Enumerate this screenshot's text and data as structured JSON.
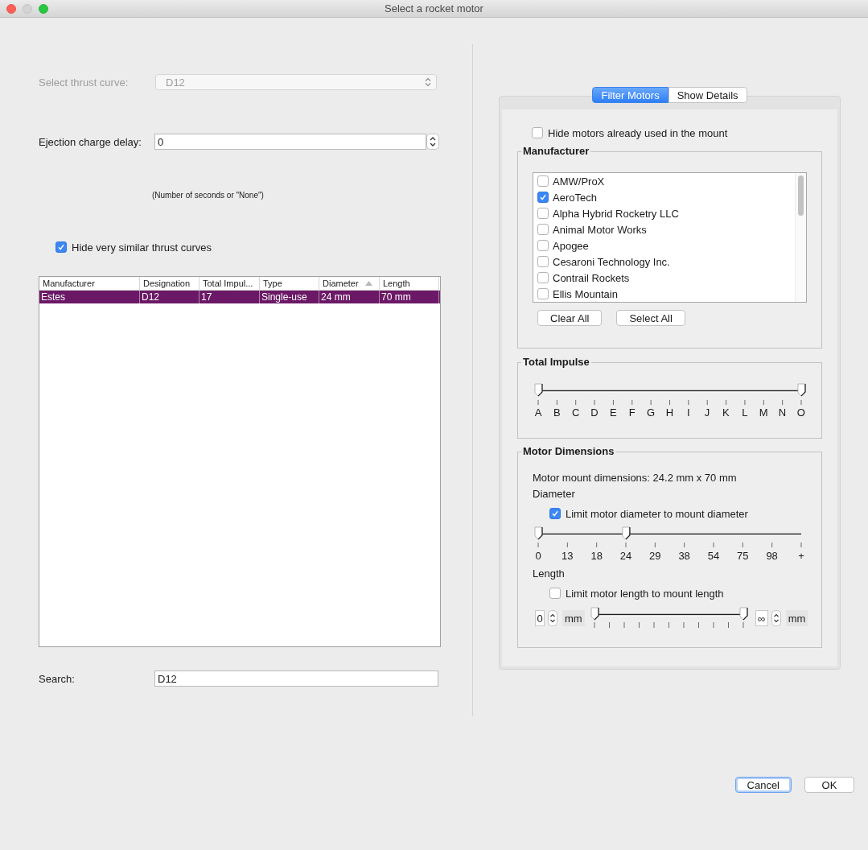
{
  "window": {
    "title": "Select a rocket motor",
    "controls": [
      {
        "kind": "close",
        "disabled": false
      },
      {
        "kind": "minimize",
        "disabled": true
      },
      {
        "kind": "zoom",
        "disabled": false
      }
    ]
  },
  "thrust_curve": {
    "label": "Select thrust curve:",
    "value": "D12",
    "disabled": true
  },
  "ejection_delay": {
    "label": "Ejection charge delay:",
    "value": "0",
    "note": "(Number of seconds or \"None\")"
  },
  "hide_similar": {
    "label": "Hide very similar thrust curves",
    "checked": true
  },
  "table": {
    "columns": [
      {
        "label": "Manufacturer",
        "sorted": false
      },
      {
        "label": "Designation",
        "sorted": false
      },
      {
        "label": "Total Impul...",
        "sorted": false
      },
      {
        "label": "Type",
        "sorted": false
      },
      {
        "label": "Diameter",
        "sorted": true
      },
      {
        "label": "Length",
        "sorted": false
      }
    ],
    "rows": [
      {
        "cells": [
          "Estes",
          "D12",
          "17",
          "Single-use",
          "24 mm",
          "70 mm"
        ],
        "selected": true
      }
    ]
  },
  "search": {
    "label": "Search:",
    "value": "D12"
  },
  "tabs": [
    {
      "label": "Filter Motors",
      "selected": true
    },
    {
      "label": "Show Details",
      "selected": false
    }
  ],
  "filter": {
    "hide_used": {
      "label": "Hide motors already used in the mount",
      "checked": false
    },
    "manufacturer": {
      "title": "Manufacturer",
      "items": [
        {
          "label": "AMW/ProX",
          "checked": false
        },
        {
          "label": "AeroTech",
          "checked": true
        },
        {
          "label": "Alpha Hybrid Rocketry LLC",
          "checked": false
        },
        {
          "label": "Animal Motor Works",
          "checked": false
        },
        {
          "label": "Apogee",
          "checked": false
        },
        {
          "label": "Cesaroni Technology Inc.",
          "checked": false
        },
        {
          "label": "Contrail Rockets",
          "checked": false
        },
        {
          "label": "Ellis Mountain",
          "checked": false
        }
      ],
      "buttons": [
        "Clear All",
        "Select All"
      ]
    },
    "total_impulse": {
      "title": "Total Impulse",
      "ticks": [
        "A",
        "B",
        "C",
        "D",
        "E",
        "F",
        "G",
        "H",
        "I",
        "J",
        "K",
        "L",
        "M",
        "N",
        "O"
      ],
      "thumbs": [
        {
          "level": 0
        },
        {
          "level": 1
        }
      ]
    },
    "motor_dimensions": {
      "title": "Motor Dimensions",
      "mount_text": "Motor mount dimensions: 24.2 mm x 70 mm",
      "diameter": {
        "label": "Diameter",
        "limit": {
          "label": "Limit motor diameter to mount diameter",
          "checked": true
        },
        "ticks": [
          "0",
          "13",
          "18",
          "24",
          "29",
          "38",
          "54",
          "75",
          "98",
          "+"
        ],
        "thumbs": [
          {
            "level": 0
          },
          {
            "level": 0.333
          }
        ]
      },
      "length": {
        "label": "Length",
        "limit": {
          "label": "Limit motor length to mount length",
          "checked": false
        },
        "min": {
          "value": "0",
          "unit": "mm"
        },
        "max": {
          "value": "∞",
          "unit": "mm"
        },
        "thumbs": [
          {
            "level": 0
          },
          {
            "level": 1
          }
        ]
      }
    }
  },
  "buttons": [
    {
      "label": "Cancel",
      "default": true
    },
    {
      "label": "OK",
      "default": false
    }
  ]
}
